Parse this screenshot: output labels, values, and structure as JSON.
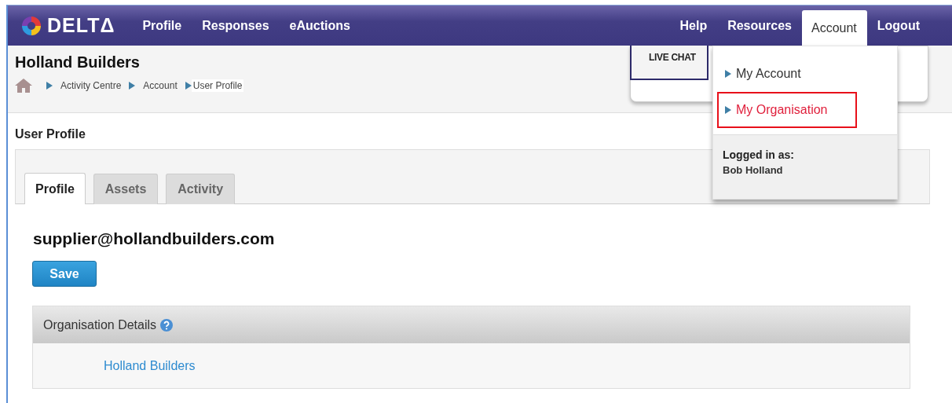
{
  "logo": {
    "text": "DELTΔ"
  },
  "nav_left": [
    {
      "label": "Profile",
      "selected": false
    },
    {
      "label": "Responses",
      "selected": false
    },
    {
      "label": "eAuctions",
      "selected": false
    }
  ],
  "nav_right": [
    {
      "label": "Help",
      "selected": false
    },
    {
      "label": "Resources",
      "selected": false
    },
    {
      "label": "Account",
      "selected": true
    },
    {
      "label": "Logout",
      "selected": false
    }
  ],
  "header": {
    "title": "Holland Builders",
    "breadcrumbs": [
      "Activity Centre",
      "Account",
      "User Profile"
    ]
  },
  "live_chat": {
    "label": "LIVE CHAT"
  },
  "account_menu": {
    "items": [
      {
        "label": "My Account",
        "highlighted": false
      },
      {
        "label": "My Organisation",
        "highlighted": true
      }
    ],
    "logged_in_label": "Logged in as:",
    "user": "Bob Holland"
  },
  "page_title": "User Profile",
  "tabs": [
    {
      "label": "Profile",
      "selected": true
    },
    {
      "label": "Assets",
      "selected": false
    },
    {
      "label": "Activity",
      "selected": false
    }
  ],
  "email": "supplier@hollandbuilders.com",
  "save_button": "Save",
  "organisation_panel": {
    "title": "Organisation Details",
    "link": "Holland Builders"
  }
}
